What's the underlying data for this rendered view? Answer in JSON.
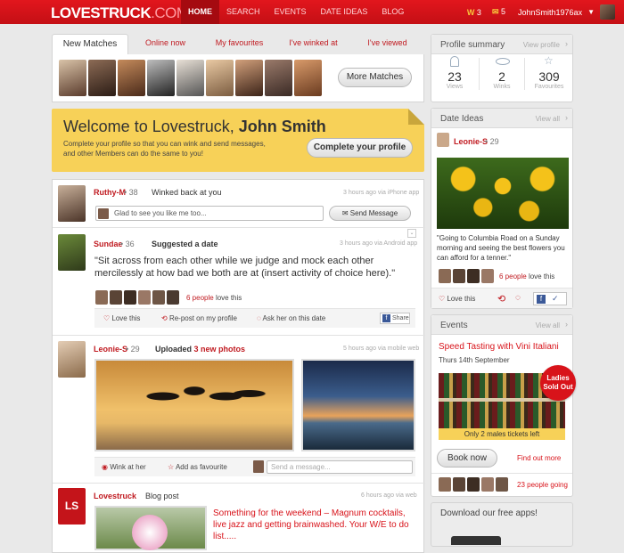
{
  "topbar": {
    "logo_main": "LOVESTRUCK",
    "logo_suffix": ".COM",
    "nav": [
      "HOME",
      "SEARCH",
      "EVENTS",
      "DATE IDEAS",
      "BLOG"
    ],
    "winks_count": "3",
    "messages_count": "5",
    "username": "JohnSmith1976ax"
  },
  "matches": {
    "tabs": [
      "New Matches",
      "Online now",
      "My favourites",
      "I've winked at",
      "I've viewed"
    ],
    "more_button": "More Matches"
  },
  "welcome": {
    "title_prefix": "Welcome to Lovestruck,",
    "title_name": "John Smith",
    "text": "Complete your profile so that you can wink and send messages, and other Members can do the same to you!",
    "button": "Complete your profile"
  },
  "feed": {
    "item1": {
      "name": "Ruthy-M",
      "age": "38",
      "action": "Winked back at you",
      "meta": "3 hours ago via iPhone app",
      "reply": "Glad to see you like me too...",
      "send_button": "Send Message"
    },
    "item2": {
      "name": "Sundae",
      "age": "36",
      "action": "Suggested a date",
      "meta": "3 hours ago via Android app",
      "quote": "\"Sit across from each other while we judge and mock each other mercilessly at how bad we both are at (insert activity of choice here).\"",
      "likes_count": "6 people",
      "likes_suffix": "love this",
      "love_label": "Love this",
      "repost_label": "Re-post on my profile",
      "ask_label": "Ask her on this date",
      "share_label": "Share"
    },
    "item3": {
      "name": "Leonie-S",
      "age": "29",
      "action_prefix": "Uploaded",
      "action_link": "3 new photos",
      "meta": "5 hours ago via mobile web",
      "wink_label": "Wink at her",
      "fav_label": "Add as favourite",
      "message_placeholder": "Send a message..."
    },
    "item4": {
      "name": "Lovestruck",
      "action": "Blog post",
      "meta": "6 hours ago via web",
      "logo_text": "LS",
      "headline": "Something for the weekend – Magnum cocktails, live jazz and getting brainwashed. Your W/E to do list....."
    }
  },
  "profile_summary": {
    "title": "Profile summary",
    "link": "View profile",
    "stats": [
      {
        "value": "23",
        "label": "Views"
      },
      {
        "value": "2",
        "label": "Winks"
      },
      {
        "value": "309",
        "label": "Favourites"
      }
    ]
  },
  "date_ideas": {
    "title": "Date Ideas",
    "link": "View all",
    "name": "Leonie-S",
    "age": "29",
    "text": "\"Going to Columbia Road on a Sunday morning and seeing the best flowers you can afford for a tenner.\"",
    "likes_count": "6 people",
    "likes_suffix": "love this",
    "love_label": "Love this"
  },
  "events": {
    "title": "Events",
    "link": "View all",
    "event_title": "Speed Tasting with Vini Italiani",
    "date": "Thurs 14th September",
    "badge_line1": "Ladies",
    "badge_line2": "Sold Out",
    "tickets": "Only 2 males tickets left",
    "book_button": "Book now",
    "find_more": "Find out more",
    "going": "23 people going"
  },
  "apps": {
    "title": "Download our free apps!"
  },
  "colors": {
    "brand_red": "#d8131a",
    "welcome_yellow": "#f7d158"
  }
}
